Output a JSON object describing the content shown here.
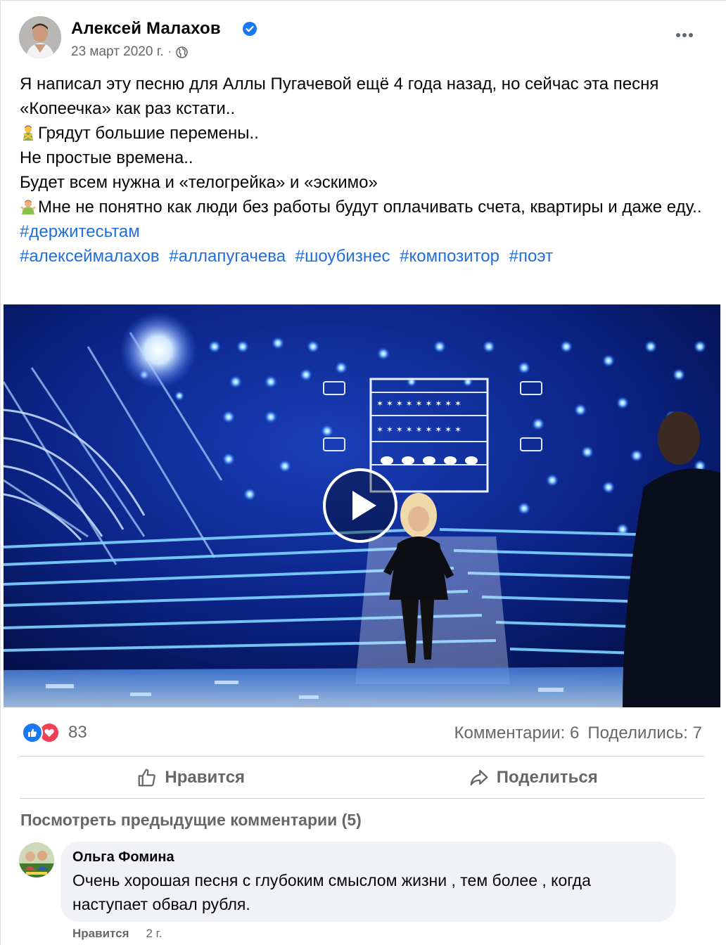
{
  "post": {
    "author": "Алексей Малахов",
    "date": "23 март 2020 г.",
    "separator": "·",
    "lines": [
      "Я написал эту песню для Аллы Пугачевой ещё 4 года назад, но сейчас эта песня «Копеечка» как раз кстати..",
      "Грядут большие перемены..",
      "Не простые времена..",
      "Будет всем нужна и «телогрейка» и «эскимо»",
      "Мне не понятно как люди без работы будут оплачивать счета, квартиры и даже еду.."
    ],
    "hashtag_line1": "#держитесьтам",
    "hashtags": [
      "#алексеймалахов",
      "#аллапугачева",
      "#шоубизнес",
      "#композитор",
      "#поэт"
    ]
  },
  "stats": {
    "reaction_count": "83",
    "comments": "Комментарии: 6",
    "shares": "Поделились: 7"
  },
  "actions": {
    "like": "Нравится",
    "share": "Поделиться"
  },
  "comments_section": {
    "view_previous": "Посмотреть предыдущие комментарии (5)",
    "comment": {
      "name": "Ольга Фомина",
      "text": "Очень хорошая песня с глубоким смыслом жизни , тем более , когда наступает обвал рубля.",
      "like": "Нравится",
      "age": "2 г."
    }
  },
  "colors": {
    "link": "#216fdb",
    "muted": "#65676b",
    "like_blue": "#1877f2",
    "love_red": "#f33e58"
  }
}
